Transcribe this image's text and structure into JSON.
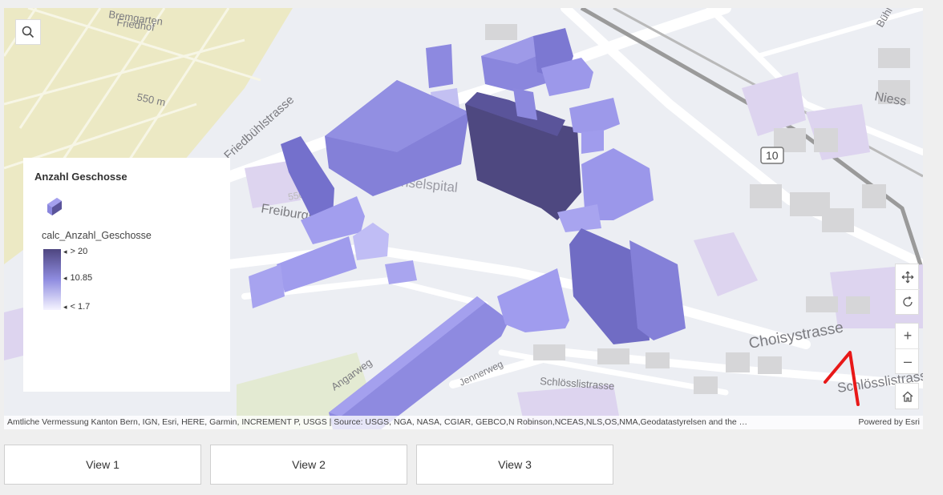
{
  "map": {
    "labels": {
      "cemetery": [
        "Bremgarten",
        "Friedhof"
      ],
      "elevation": "550 m",
      "elevation2": "550 m",
      "street_friedbuhl": "Friedbühlstrasse",
      "street_freiburg": "Freiburgstrasse",
      "inselspital": "Inselspital",
      "street_choisy": "Choisystrasse",
      "street_schlossli": "Schlösslistrasse",
      "street_schlossli2": "Schlösslistrasse",
      "street_jenner": "Jennerweg",
      "street_angar": "Angarweg",
      "street_niesen": "Niess",
      "street_buhl": "Bühl",
      "route_shield": "10"
    },
    "attribution": "Amtliche Vermessung Kanton Bern, IGN, Esri, HERE, Garmin, INCREMENT P, USGS | Source: USGS, NGA, NASA, CGIAR, GEBCO,N Robinson,NCEAS,NLS,OS,NMA,Geodatastyrelsen and the …",
    "powered_by": "Powered by Esri",
    "annotation_glyph": "1"
  },
  "legend": {
    "title": "Anzahl Geschosse",
    "field": "calc_Anzahl_Geschosse",
    "ramp": {
      "max_label": "> 20",
      "mid_label": "10.85",
      "min_label": "< 1.7",
      "colors": [
        "#4e4680",
        "#8f8ce0",
        "#f5f4ff"
      ]
    }
  },
  "controls": {
    "pan": "pan-icon",
    "rotate": "rotate-icon",
    "zoom_in": "+",
    "zoom_out": "–",
    "home": "home-icon"
  },
  "views": [
    "View 1",
    "View 2",
    "View 3"
  ]
}
